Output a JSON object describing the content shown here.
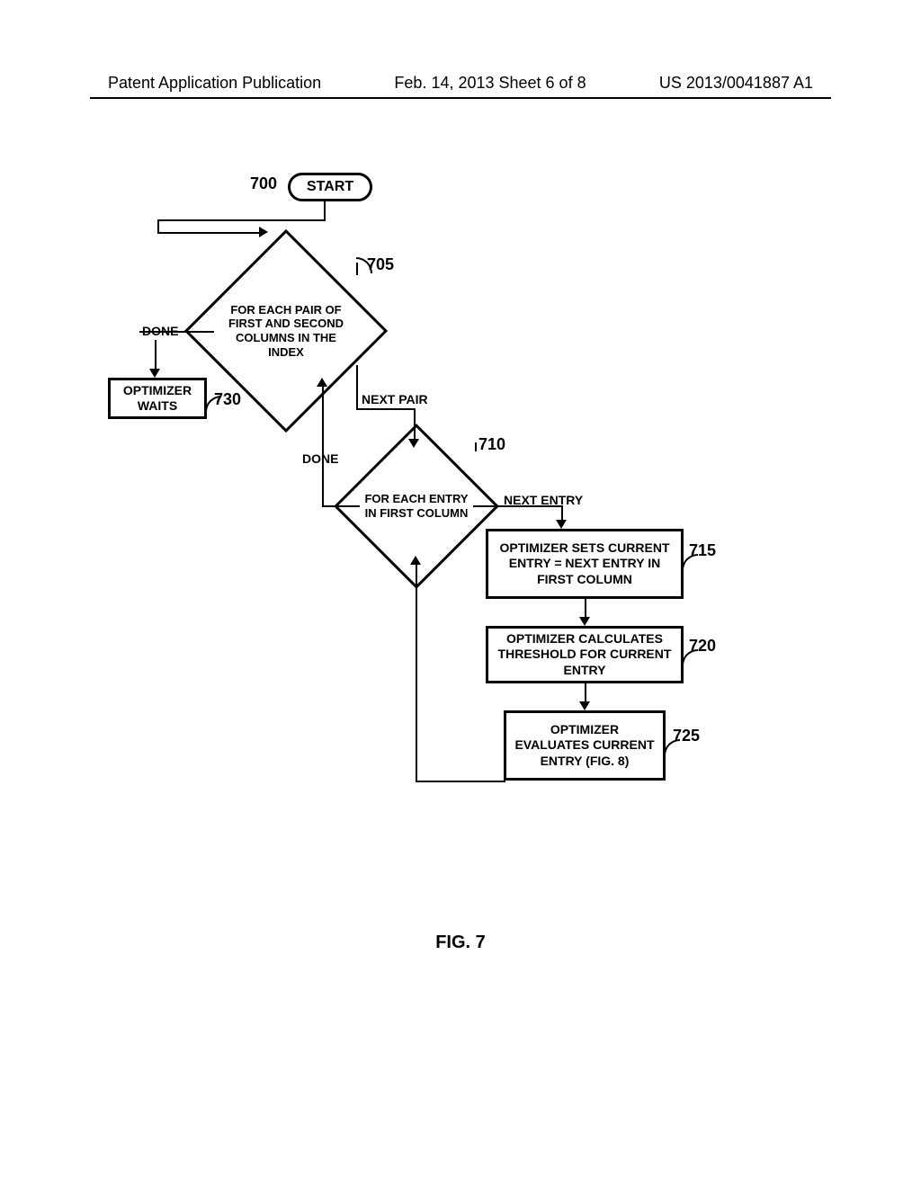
{
  "header": {
    "left": "Patent Application Publication",
    "mid": "Feb. 14, 2013  Sheet 6 of 8",
    "right": "US 2013/0041887 A1"
  },
  "figure": {
    "caption": "FIG. 7",
    "start_label": "START",
    "ref_700": "700",
    "ref_705": "705",
    "ref_710": "710",
    "ref_715": "715",
    "ref_720": "720",
    "ref_725": "725",
    "ref_730": "730",
    "diamond_705_text": "FOR EACH PAIR OF FIRST AND SECOND COLUMNS IN THE INDEX",
    "diamond_710_text": "FOR EACH ENTRY IN FIRST COLUMN",
    "edge_done1": "DONE",
    "edge_nextpair": "NEXT PAIR",
    "edge_done2": "DONE",
    "edge_nextentry": "NEXT ENTRY",
    "box_wait": "OPTIMIZER WAITS",
    "box_715": "OPTIMIZER SETS CURRENT ENTRY = NEXT ENTRY IN FIRST COLUMN",
    "box_720": "OPTIMIZER CALCULATES THRESHOLD FOR CURRENT ENTRY",
    "box_725": "OPTIMIZER EVALUATES CURRENT ENTRY (FIG. 8)"
  },
  "chart_data": {
    "type": "flowchart",
    "title": "FIG. 7",
    "nodes": [
      {
        "id": "start",
        "type": "terminator",
        "label": "START",
        "ref": "700"
      },
      {
        "id": "d705",
        "type": "decision",
        "label": "FOR EACH PAIR OF FIRST AND SECOND COLUMNS IN THE INDEX",
        "ref": "705"
      },
      {
        "id": "wait",
        "type": "process",
        "label": "OPTIMIZER WAITS",
        "ref": "730"
      },
      {
        "id": "d710",
        "type": "decision",
        "label": "FOR EACH ENTRY IN FIRST COLUMN",
        "ref": "710"
      },
      {
        "id": "p715",
        "type": "process",
        "label": "OPTIMIZER SETS CURRENT ENTRY = NEXT ENTRY IN FIRST COLUMN",
        "ref": "715"
      },
      {
        "id": "p720",
        "type": "process",
        "label": "OPTIMIZER CALCULATES THRESHOLD FOR CURRENT ENTRY",
        "ref": "720"
      },
      {
        "id": "p725",
        "type": "process",
        "label": "OPTIMIZER EVALUATES CURRENT ENTRY (FIG. 8)",
        "ref": "725"
      }
    ],
    "edges": [
      {
        "from": "start",
        "to": "d705",
        "label": ""
      },
      {
        "from": "d705",
        "to": "wait",
        "label": "DONE"
      },
      {
        "from": "d705",
        "to": "d710",
        "label": "NEXT PAIR"
      },
      {
        "from": "d710",
        "to": "d705",
        "label": "DONE"
      },
      {
        "from": "d710",
        "to": "p715",
        "label": "NEXT ENTRY"
      },
      {
        "from": "p715",
        "to": "p720",
        "label": ""
      },
      {
        "from": "p720",
        "to": "p725",
        "label": ""
      },
      {
        "from": "p725",
        "to": "d710",
        "label": ""
      }
    ]
  }
}
